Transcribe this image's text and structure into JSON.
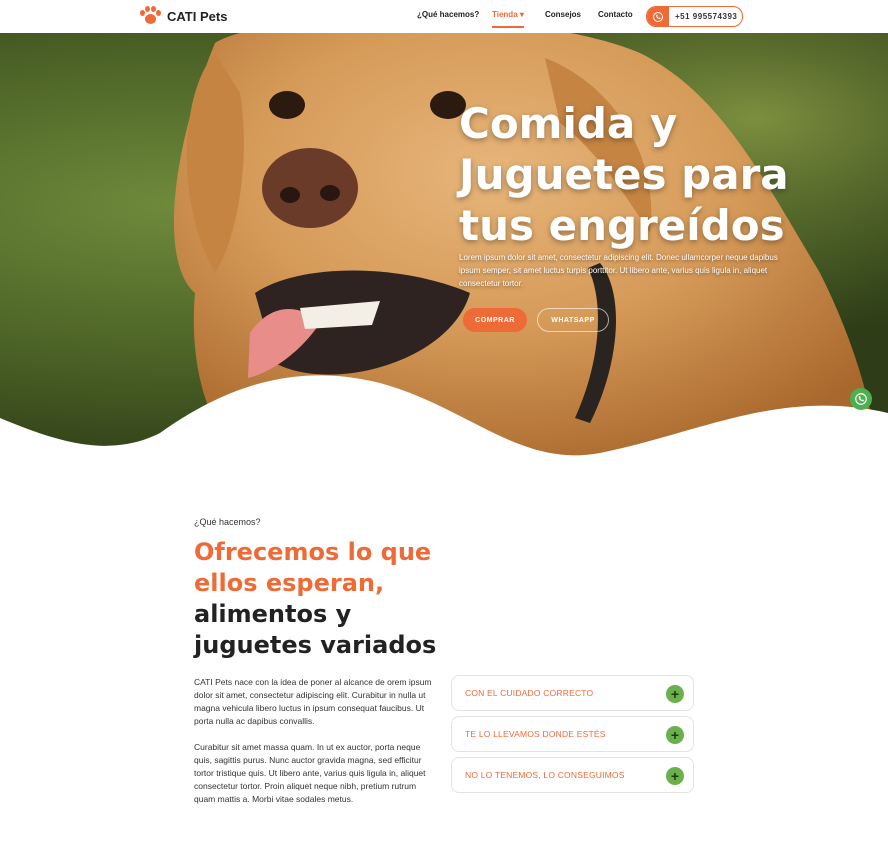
{
  "nav": {
    "logo_text": "CATI Pets",
    "items": [
      "¿Qué hacemos?",
      "Tienda ▾",
      "Consejos",
      "Contacto"
    ],
    "phone": "+51 995574393"
  },
  "hero": {
    "title": "Comida y Juguetes para tus engreídos",
    "text": "Lorem ipsum dolor sit amet, consectetur adipiscing elit. Donec ullamcorper neque dapibus ipsum semper, sit amet luctus turpis porttitor. Ut libero ante, varius quis ligula in, aliquet consectetur tortor.",
    "buy_label": "COMPRAR",
    "whatsapp_label": "WHATSAPP"
  },
  "about": {
    "eyebrow": "¿Qué hacemos?",
    "title_accent": "Ofrecemos lo que ellos esperan,",
    "title_dark": "alimentos y juguetes variados",
    "paragraphs": [
      "CATI Pets nace con la idea de poner al alcance de orem ipsum dolor sit amet, consectetur adipiscing elit. Curabitur in nulla ut magna vehicula libero luctus in ipsum consequat faucibus. Ut porta nulla ac dapibus convallis.",
      "Curabitur sit amet massa quam. In ut ex auctor, porta neque quis, sagittis purus. Nunc auctor gravida magna, sed efficitur tortor tristique quis. Ut libero ante, varius quis ligula in, aliquet consectetur tortor. Proin aliquet neque nibh, pretium rutrum quam mattis a. Morbi vitae sodales metus."
    ],
    "accordion": [
      "CON EL CUIDADO CORRECTO",
      "TE  LO LLEVAMOS DONDE ESTÉS",
      "NO LO TENEMOS, LO CONSEGUIMOS"
    ]
  },
  "colors": {
    "accent": "#ee6b38",
    "green": "#6ab04c"
  },
  "icons": {
    "logo": "paw-icon",
    "phone": "whatsapp-icon",
    "float": "whatsapp-icon",
    "accordion": "plus-icon"
  }
}
